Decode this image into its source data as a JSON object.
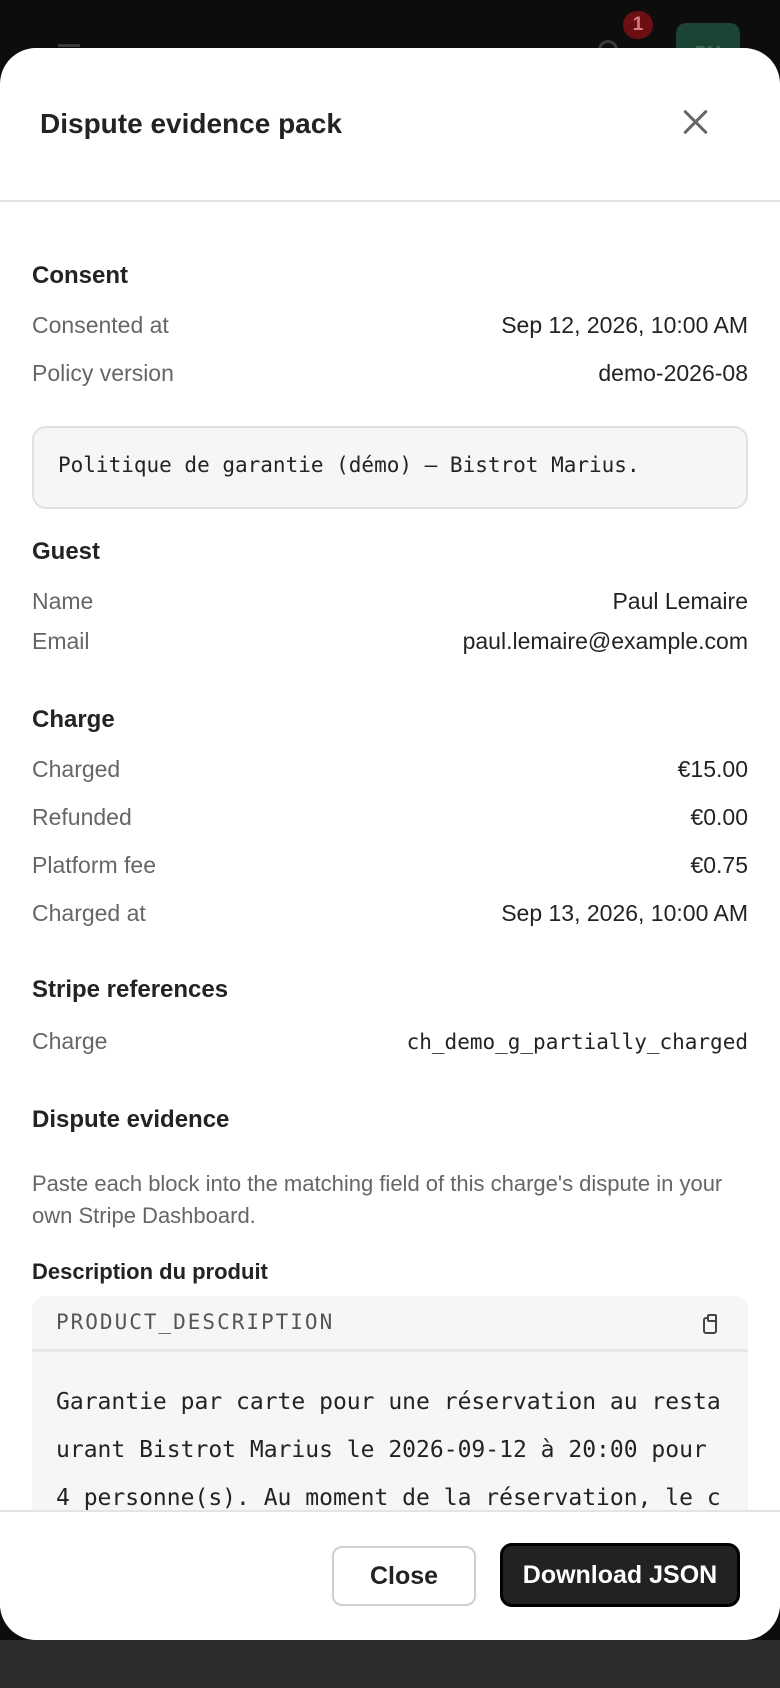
{
  "app_bar": {
    "notification_count": "1",
    "avatar_initials": "PM"
  },
  "modal": {
    "title": "Dispute evidence pack",
    "close_icon": "close-icon"
  },
  "consent": {
    "title": "Consent",
    "consented_at_label": "Consented at",
    "consented_at_value": "Sep 12, 2026, 10:00 AM",
    "policy_version_label": "Policy version",
    "policy_version_value": "demo-2026-08",
    "policy_text": "Politique de garantie (démo) — Bistrot Marius."
  },
  "guest": {
    "title": "Guest",
    "name_label": "Name",
    "name_value": "Paul Lemaire",
    "email_label": "Email",
    "email_value": "paul.lemaire@example.com"
  },
  "charge": {
    "title": "Charge",
    "charged_label": "Charged",
    "charged_value": "€15.00",
    "refunded_label": "Refunded",
    "refunded_value": "€0.00",
    "platform_fee_label": "Platform fee",
    "platform_fee_value": "€0.75",
    "charged_at_label": "Charged at",
    "charged_at_value": "Sep 13, 2026, 10:00 AM"
  },
  "stripe_refs": {
    "title": "Stripe references",
    "charge_label": "Charge",
    "charge_value": "ch_demo_g_partially_charged"
  },
  "dispute_evidence": {
    "title": "Dispute evidence",
    "helper": "Paste each block into the matching field of this charge's dispute in your own Stripe Dashboard.",
    "field_label": "Description du produit",
    "field_key": "PRODUCT_DESCRIPTION",
    "copy_icon": "clipboard-icon",
    "field_text": "Garantie par carte pour une réservation au restaurant Bistrot Marius le 2026-09-12 à 20:00 pour 4 personne(s). Au moment de la réservation, le client a autorisé une empreinte de carte"
  },
  "footer": {
    "close_label": "Close",
    "download_label": "Download JSON"
  }
}
